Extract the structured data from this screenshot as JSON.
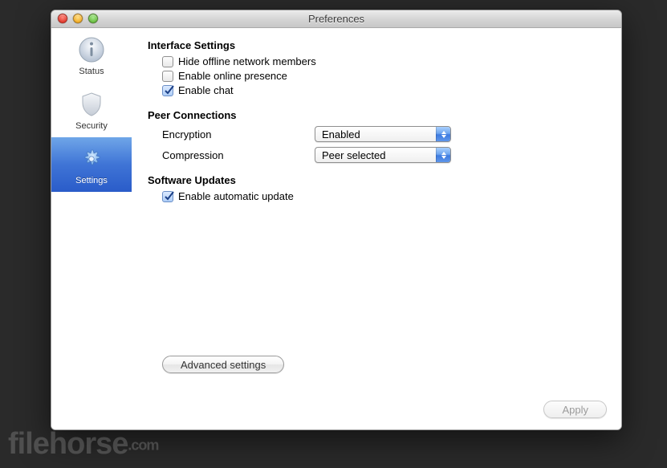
{
  "window": {
    "title": "Preferences"
  },
  "sidebar": {
    "items": [
      {
        "label": "Status"
      },
      {
        "label": "Security"
      },
      {
        "label": "Settings"
      }
    ],
    "selected_index": 2
  },
  "sections": {
    "interface": {
      "heading": "Interface Settings",
      "options": [
        {
          "label": "Hide offline network members",
          "checked": false
        },
        {
          "label": "Enable online presence",
          "checked": false
        },
        {
          "label": "Enable chat",
          "checked": true
        }
      ]
    },
    "peer": {
      "heading": "Peer Connections",
      "rows": [
        {
          "label": "Encryption",
          "value": "Enabled"
        },
        {
          "label": "Compression",
          "value": "Peer selected"
        }
      ]
    },
    "updates": {
      "heading": "Software Updates",
      "options": [
        {
          "label": "Enable automatic update",
          "checked": true
        }
      ]
    }
  },
  "buttons": {
    "advanced": "Advanced settings",
    "apply": "Apply"
  },
  "watermark": {
    "main": "filehorse",
    "suffix": ".com"
  }
}
